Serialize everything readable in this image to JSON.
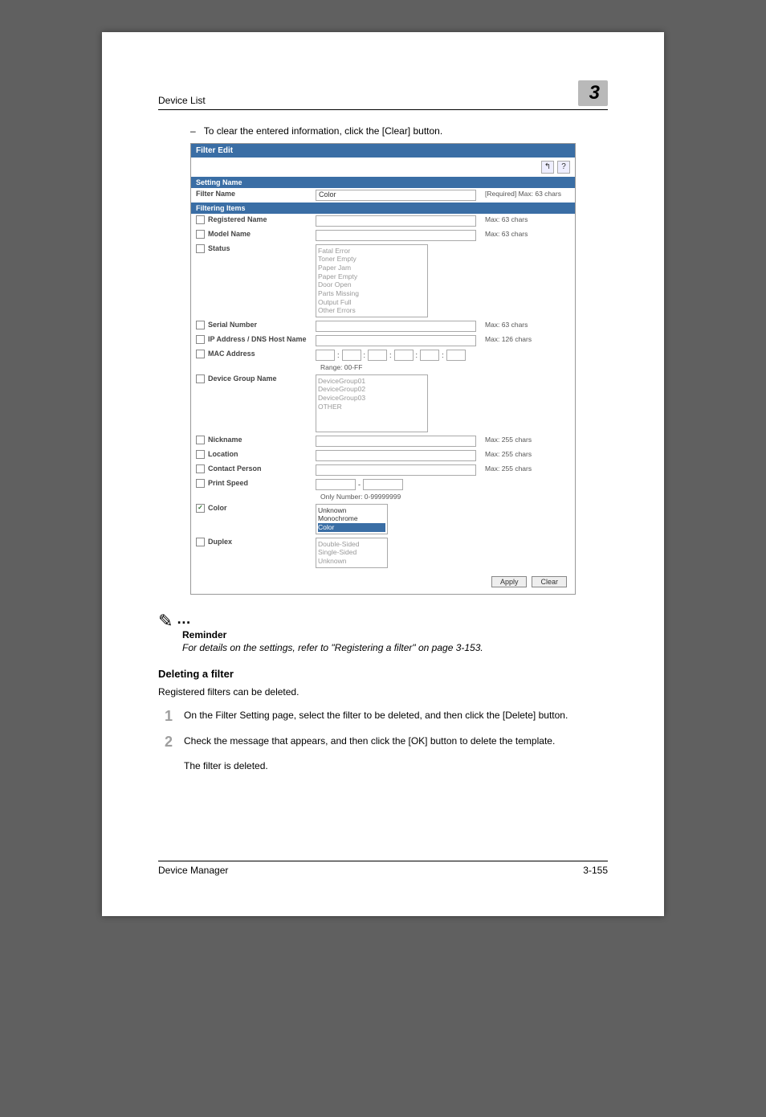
{
  "header": {
    "section_title": "Device List",
    "chapter_number": "3"
  },
  "bullet": {
    "dash": "–",
    "text": "To clear the entered information, click the [Clear] button."
  },
  "screenshot": {
    "window_title": "Filter Edit",
    "icons": {
      "back": "↰",
      "help": "?"
    },
    "sections": {
      "setting_name": "Setting Name",
      "filtering_items": "Filtering Items"
    },
    "rows": {
      "filter_name": {
        "label": "Filter Name",
        "value": "Color",
        "hint": "[Required] Max: 63 chars"
      },
      "registered_name": {
        "label": "Registered Name",
        "hint": "Max: 63 chars"
      },
      "model_name": {
        "label": "Model Name",
        "hint": "Max: 63 chars"
      },
      "status": {
        "label": "Status",
        "options": [
          "Fatal Error",
          "Toner Empty",
          "Paper Jam",
          "Paper Empty",
          "Door Open",
          "Parts Missing",
          "Output Full",
          "Other Errors"
        ]
      },
      "serial_number": {
        "label": "Serial Number",
        "hint": "Max: 63 chars"
      },
      "ip_dns": {
        "label": "IP Address / DNS Host Name",
        "hint": "Max: 126 chars"
      },
      "mac": {
        "label": "MAC Address",
        "range": "Range: 00-FF"
      },
      "device_group": {
        "label": "Device Group Name",
        "options": [
          "DeviceGroup01",
          "DeviceGroup02",
          "  DeviceGroup03",
          "OTHER"
        ]
      },
      "nickname": {
        "label": "Nickname",
        "hint": "Max: 255 chars"
      },
      "location": {
        "label": "Location",
        "hint": "Max: 255 chars"
      },
      "contact": {
        "label": "Contact Person",
        "hint": "Max: 255 chars"
      },
      "print_speed": {
        "label": "Print Speed",
        "sep": "-",
        "range": "Only Number: 0-99999999"
      },
      "color": {
        "label": "Color",
        "checked": true,
        "options": [
          "Unknown",
          "Monochrome",
          "Color"
        ],
        "selected": "Color"
      },
      "duplex": {
        "label": "Duplex",
        "options": [
          "Double-Sided",
          "Single-Sided",
          "Unknown"
        ]
      }
    },
    "buttons": {
      "apply": "Apply",
      "clear": "Clear"
    }
  },
  "note": {
    "icon": "✎",
    "dots": "…",
    "head": "Reminder",
    "body": "For details on the settings, refer to \"Registering a filter\" on page 3-153."
  },
  "deleting": {
    "title": "Deleting a filter",
    "intro": "Registered filters can be deleted.",
    "step1": {
      "num": "1",
      "text": "On the Filter Setting page, select the filter to be deleted, and then click the [Delete] button."
    },
    "step2": {
      "num": "2",
      "text": "Check the message that appears, and then click the [OK] button to delete the template."
    },
    "result": "The filter is deleted."
  },
  "footer": {
    "left": "Device Manager",
    "right": "3-155"
  }
}
